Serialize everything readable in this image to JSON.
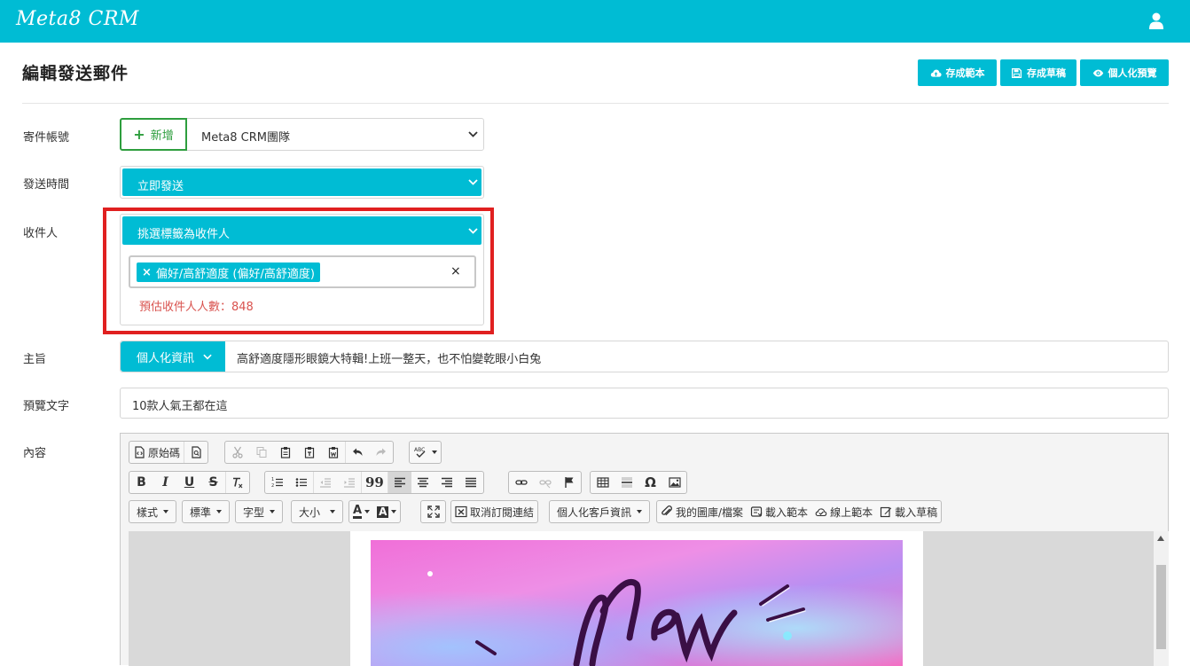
{
  "app": {
    "logo": "Meta8 CRM"
  },
  "header": {
    "title": "編輯發送郵件",
    "save_template": "存成範本",
    "save_draft": "存成草稿",
    "preview": "個人化預覽"
  },
  "form": {
    "sender": {
      "label": "寄件帳號",
      "new_button": "新增",
      "value": "Meta8 CRM團隊"
    },
    "send_time": {
      "label": "發送時間",
      "value": "立即發送"
    },
    "recipients": {
      "label": "收件人",
      "select": "挑選標籤為收件人",
      "tag": "偏好/高舒適度 (偏好/高舒適度)",
      "tag_remove": "×",
      "clear": "×",
      "estimate": "預估收件人人數：848"
    },
    "subject": {
      "label": "主旨",
      "personal_button": "個人化資訊",
      "value": "高舒適度隱形眼鏡大特輯!上班一整天，也不怕變乾眼小白兔"
    },
    "preview_text": {
      "label": "預覽文字",
      "value": "10款人氣王都在這"
    },
    "content": {
      "label": "內容"
    }
  },
  "editor": {
    "source": "原始碼",
    "style_dd": "樣式",
    "format_dd": "標準",
    "font_dd": "字型",
    "size_dd": "大小",
    "unsubscribe": "取消訂閱連結",
    "personal_dd": "個人化客戶資訊",
    "my_gallery": "我的圖庫/檔案",
    "load_template": "載入範本",
    "online_template": "線上範本",
    "load_draft": "載入草稿",
    "bold": "B",
    "italic": "I",
    "underline": "U",
    "strike": "S",
    "quote": "99",
    "omega": "Ω"
  },
  "colors": {
    "primary": "#00bcd4",
    "success": "#2e9e3e",
    "danger": "#d9534f",
    "highlight": "#e02020"
  }
}
